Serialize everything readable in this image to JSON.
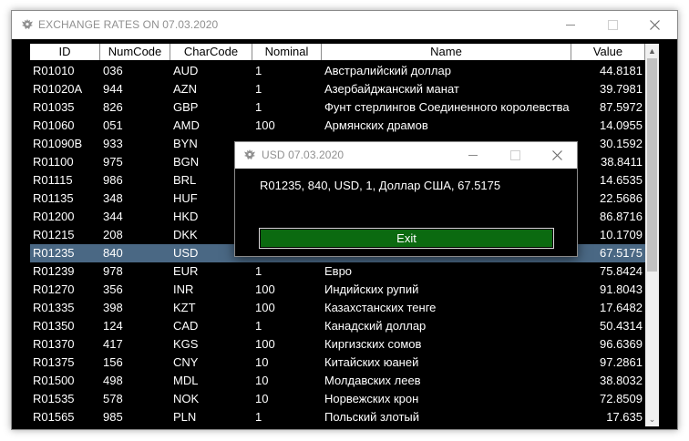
{
  "window": {
    "title": "EXCHANGE RATES ON 07.03.2020"
  },
  "table": {
    "columns": [
      "ID",
      "NumCode",
      "CharCode",
      "Nominal",
      "Name",
      "Value"
    ],
    "rows": [
      [
        "R01010",
        "036",
        "AUD",
        "1",
        "Австралийский доллар",
        "44.8181"
      ],
      [
        "R01020A",
        "944",
        "AZN",
        "1",
        "Азербайджанский манат",
        "39.7981"
      ],
      [
        "R01035",
        "826",
        "GBP",
        "1",
        "Фунт стерлингов Соединенного королевства",
        "87.5972"
      ],
      [
        "R01060",
        "051",
        "AMD",
        "100",
        "Армянских драмов",
        "14.0955"
      ],
      [
        "R01090B",
        "933",
        "BYN",
        "",
        "",
        "30.1592"
      ],
      [
        "R01100",
        "975",
        "BGN",
        "",
        "",
        "38.8411"
      ],
      [
        "R01115",
        "986",
        "BRL",
        "",
        "",
        "14.6535"
      ],
      [
        "R01135",
        "348",
        "HUF",
        "",
        "",
        "22.5686"
      ],
      [
        "R01200",
        "344",
        "HKD",
        "",
        "",
        "86.8716"
      ],
      [
        "R01215",
        "208",
        "DKK",
        "",
        "",
        "10.1709"
      ],
      [
        "R01235",
        "840",
        "USD",
        "",
        "",
        "67.5175"
      ],
      [
        "R01239",
        "978",
        "EUR",
        "1",
        "Евро",
        "75.8424"
      ],
      [
        "R01270",
        "356",
        "INR",
        "100",
        "Индийских рупий",
        "91.8043"
      ],
      [
        "R01335",
        "398",
        "KZT",
        "100",
        "Казахстанских тенге",
        "17.6482"
      ],
      [
        "R01350",
        "124",
        "CAD",
        "1",
        "Канадский доллар",
        "50.4314"
      ],
      [
        "R01370",
        "417",
        "KGS",
        "100",
        "Киргизских сомов",
        "96.6369"
      ],
      [
        "R01375",
        "156",
        "CNY",
        "10",
        "Китайских юаней",
        "97.2861"
      ],
      [
        "R01500",
        "498",
        "MDL",
        "10",
        "Молдавских леев",
        "38.8032"
      ],
      [
        "R01535",
        "578",
        "NOK",
        "10",
        "Норвежских крон",
        "72.8509"
      ],
      [
        "R01565",
        "985",
        "PLN",
        "1",
        "Польский злотый",
        "17.635"
      ]
    ],
    "selected_row": 10
  },
  "dialog": {
    "title": "USD 07.03.2020",
    "message": "R01235, 840, USD, 1, Доллар США, 67.5175",
    "exit_label": "Exit"
  },
  "icons": {
    "window_icon": "eagle-emblem-icon",
    "minimize": "minimize-icon",
    "maximize": "maximize-icon",
    "close": "close-icon",
    "scroll_up": "scroll-up-icon",
    "scroll_down": "scroll-down-icon"
  },
  "colors": {
    "selection": "#4a6884",
    "exit_button": "#0b6a10",
    "background": "#000000"
  }
}
